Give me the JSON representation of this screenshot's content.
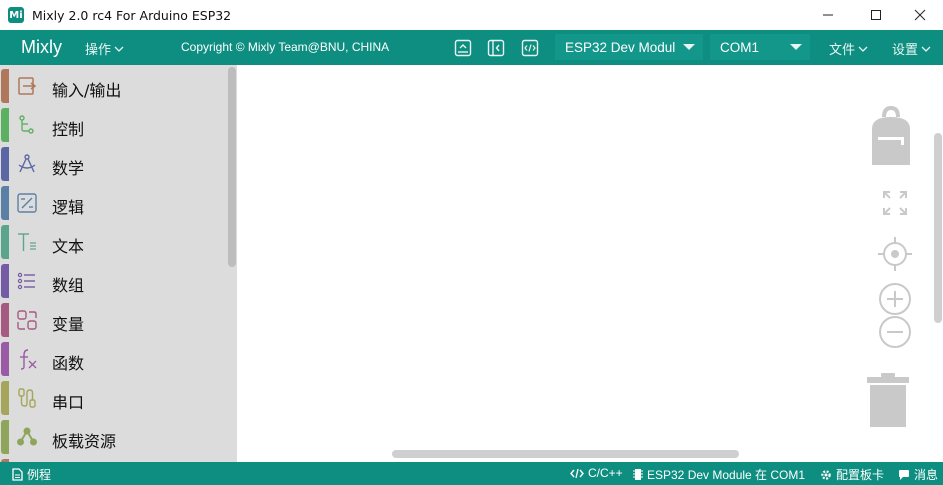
{
  "window": {
    "title": "Mixly 2.0 rc4 For Arduino ESP32",
    "app_icon_text": "Mi"
  },
  "toolbar": {
    "brand": "Mixly",
    "menu_operate": "操作",
    "copyright": "Copyright © Mixly Team@BNU, CHINA",
    "board_select": "ESP32 Dev Module",
    "port_select": "COM1",
    "menu_file": "文件",
    "menu_settings": "设置"
  },
  "sidebar": {
    "categories": [
      {
        "label": "输入/输出",
        "color": "#b0785a"
      },
      {
        "label": "控制",
        "color": "#5cb160"
      },
      {
        "label": "数学",
        "color": "#5b67a5"
      },
      {
        "label": "逻辑",
        "color": "#5b80a5"
      },
      {
        "label": "文本",
        "color": "#5ba58c"
      },
      {
        "label": "数组",
        "color": "#745ba5"
      },
      {
        "label": "变量",
        "color": "#a55b80"
      },
      {
        "label": "函数",
        "color": "#995ba5"
      },
      {
        "label": "串口",
        "color": "#a5a55b"
      },
      {
        "label": "板载资源",
        "color": "#8fa55b"
      }
    ]
  },
  "statusbar": {
    "examples": "例程",
    "language": "C/C++",
    "board_status": "ESP32 Dev Module 在 COM1",
    "configure_board": "配置板卡",
    "messages": "消息"
  },
  "colors": {
    "accent": "#0e8e80",
    "sidebar_bg": "#dcdcdc"
  }
}
